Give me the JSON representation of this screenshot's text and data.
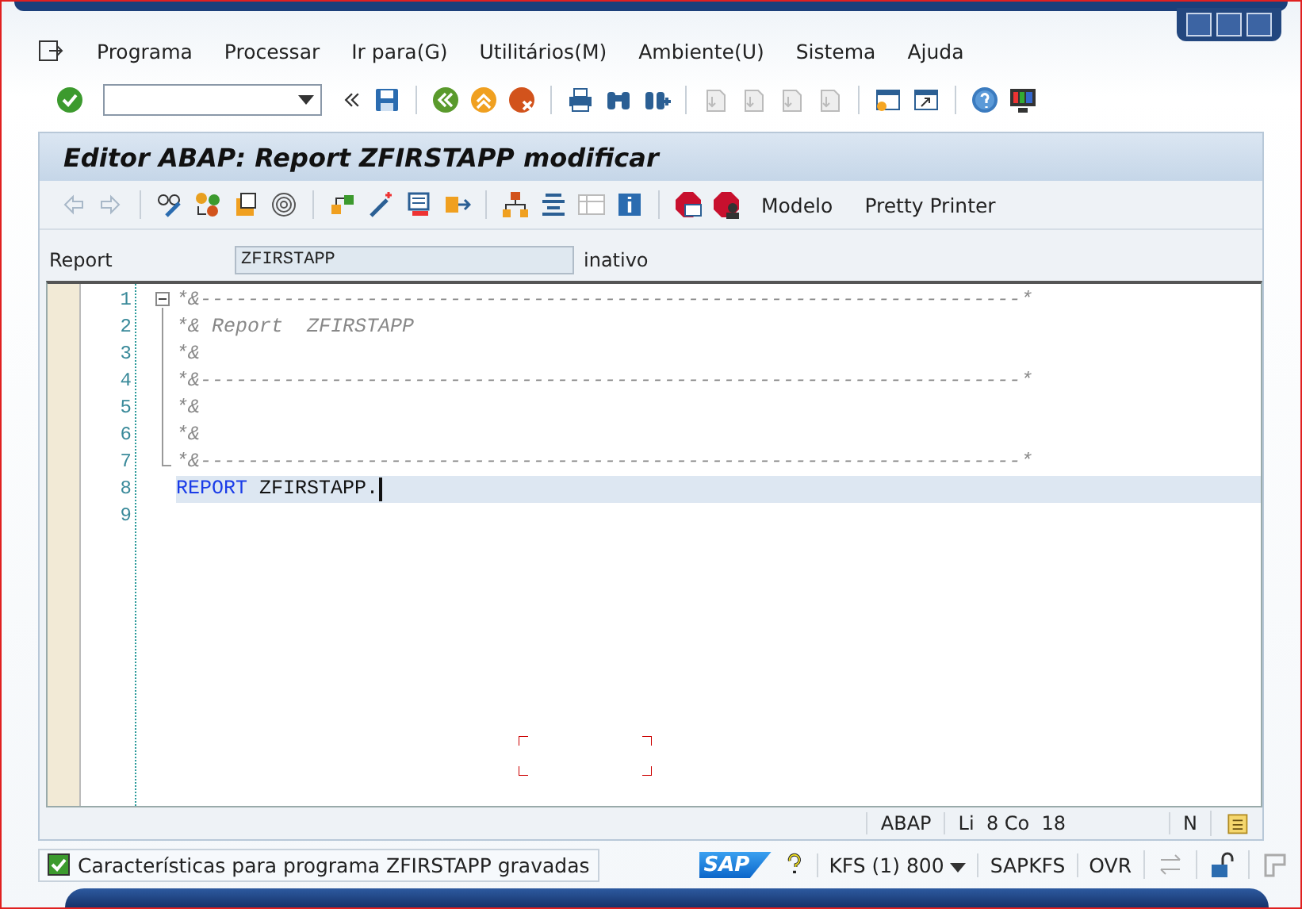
{
  "menu": [
    {
      "label": "Programa"
    },
    {
      "label": "Processar"
    },
    {
      "label": "Ir para(G)"
    },
    {
      "label": "Utilitários(M)"
    },
    {
      "label": "Ambiente(U)"
    },
    {
      "label": "Sistema"
    },
    {
      "label": "Ajuda"
    }
  ],
  "screen_title": "Editor ABAP: Report ZFIRSTAPP modificar",
  "app_toolbar_buttons": [
    "Modelo",
    "Pretty Printer"
  ],
  "report_row": {
    "label": "Report",
    "value": "ZFIRSTAPP",
    "status": "inativo"
  },
  "editor": {
    "folded_block": {
      "expanded": true
    },
    "lines": [
      {
        "number": "1",
        "current": false,
        "segments": [
          {
            "kind": "comment",
            "text": "*&---------------------------------------------------------------------*"
          }
        ]
      },
      {
        "number": "2",
        "current": false,
        "segments": [
          {
            "kind": "comment",
            "text": "*& Report  ZFIRSTAPP"
          }
        ]
      },
      {
        "number": "3",
        "current": false,
        "segments": [
          {
            "kind": "comment",
            "text": "*&"
          }
        ]
      },
      {
        "number": "4",
        "current": false,
        "segments": [
          {
            "kind": "comment",
            "text": "*&---------------------------------------------------------------------*"
          }
        ]
      },
      {
        "number": "5",
        "current": false,
        "segments": [
          {
            "kind": "comment",
            "text": "*&"
          }
        ]
      },
      {
        "number": "6",
        "current": false,
        "segments": [
          {
            "kind": "comment",
            "text": "*&"
          }
        ]
      },
      {
        "number": "7",
        "current": false,
        "segments": [
          {
            "kind": "comment",
            "text": "*&---------------------------------------------------------------------*"
          }
        ]
      },
      {
        "number": "8",
        "current": true,
        "segments": [
          {
            "kind": "keyword",
            "text": "REPORT"
          },
          {
            "kind": "plain",
            "text": " ZFIRSTAPP."
          }
        ]
      },
      {
        "number": "9",
        "current": false
      }
    ]
  },
  "editor_status": {
    "language": "ABAP",
    "position": "Li  8 Co  18",
    "mode": "N"
  },
  "status_bar": {
    "message": "Características para programa ZFIRSTAPP gravadas",
    "logo": "SAP",
    "system": "KFS (1) 800",
    "program": "SAPKFS",
    "insert_mode": "OVR"
  }
}
